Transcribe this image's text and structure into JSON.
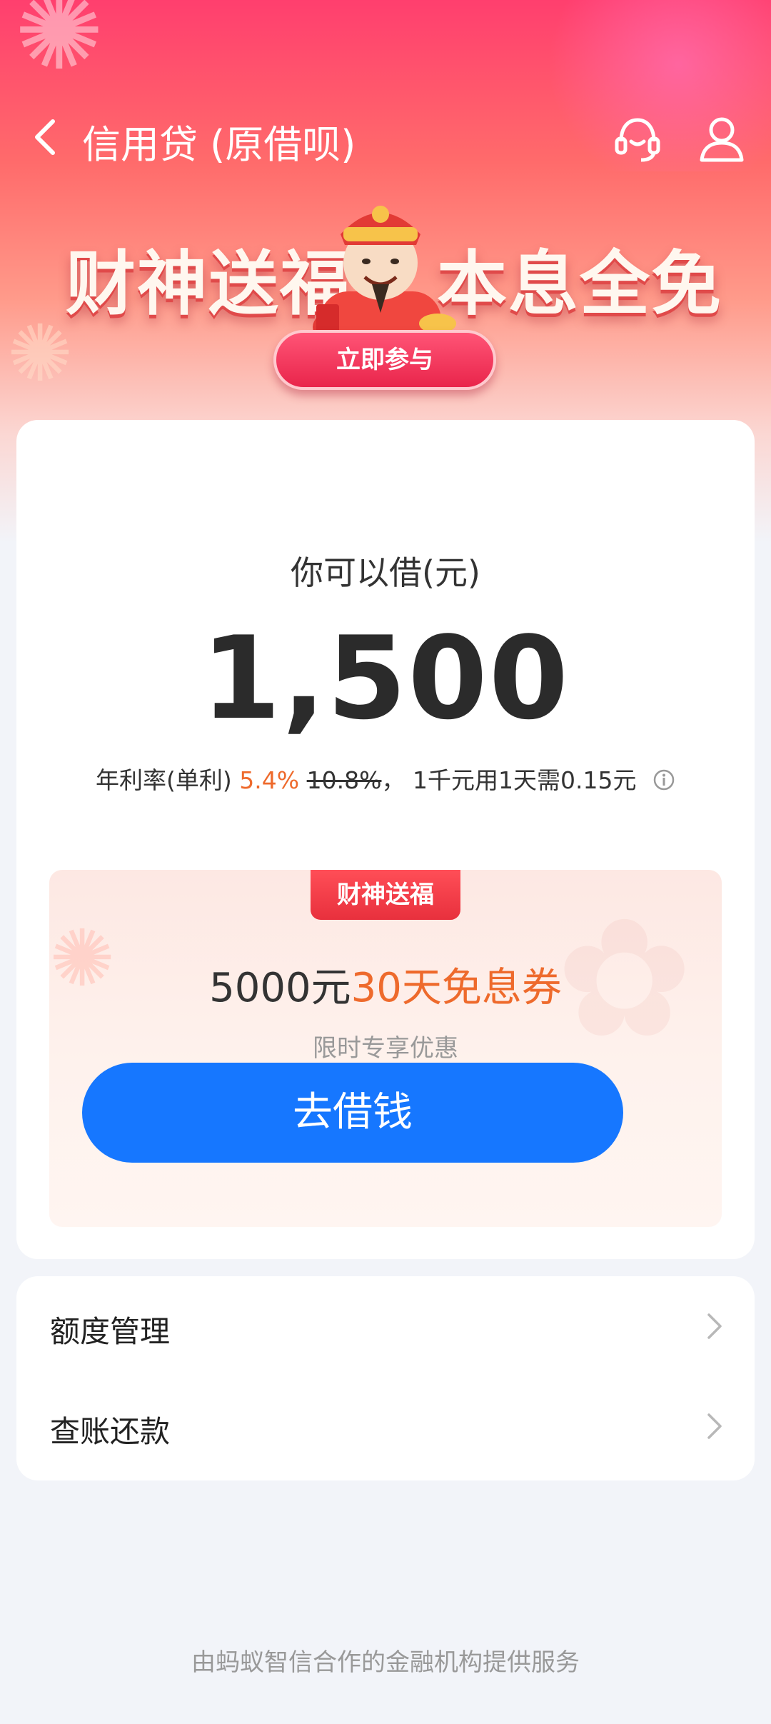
{
  "header": {
    "title": "信用贷 (原借呗)"
  },
  "banner": {
    "left_text": "财神送福",
    "right_text": "本息全免",
    "join_button": "立即参与"
  },
  "loan": {
    "can_borrow_label": "你可以借(元)",
    "amount": "1,500",
    "rate_prefix": "年利率(单利)",
    "rate_now": "5.4%",
    "rate_old": "10.8%",
    "rate_sep": "，",
    "rate_daily": "1千元用1天需0.15元"
  },
  "promo": {
    "tag": "财神送福",
    "title_part1": "5000元",
    "title_part2": "30天免息券",
    "subtitle": "限时专享优惠",
    "cta": "去借钱"
  },
  "menu": {
    "items": [
      {
        "label": "额度管理"
      },
      {
        "label": "查账还款"
      }
    ]
  },
  "footer": {
    "text": "由蚂蚁智信合作的金融机构提供服务"
  },
  "colors": {
    "accent_blue": "#1677ff",
    "accent_orange": "#ee6a2c",
    "hero_red": "#ff3f6e"
  },
  "icons": {
    "back": "chevron-left-icon",
    "support": "headset-icon",
    "profile": "user-icon",
    "info": "info-icon",
    "chevron": "chevron-right-icon"
  }
}
